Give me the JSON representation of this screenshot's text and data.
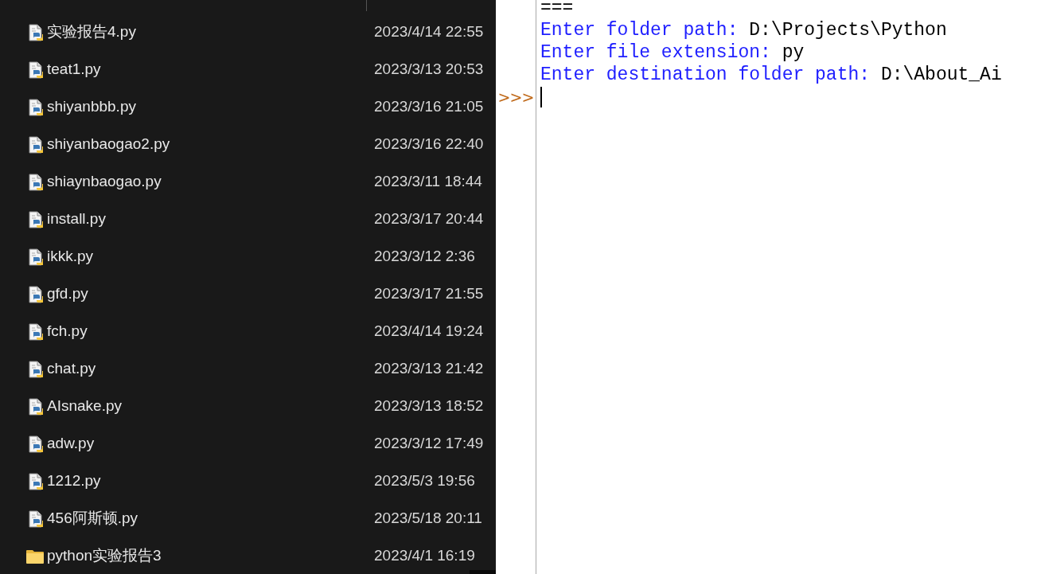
{
  "explorer": {
    "files": [
      {
        "kind": "python-file",
        "name": "实验报告4.py",
        "modified": "2023/4/14 22:55"
      },
      {
        "kind": "python-file",
        "name": "teat1.py",
        "modified": "2023/3/13 20:53"
      },
      {
        "kind": "python-file",
        "name": "shiyanbbb.py",
        "modified": "2023/3/16 21:05"
      },
      {
        "kind": "python-file",
        "name": "shiyanbaogao2.py",
        "modified": "2023/3/16 22:40"
      },
      {
        "kind": "python-file",
        "name": "shiaynbaogao.py",
        "modified": "2023/3/11 18:44"
      },
      {
        "kind": "python-file",
        "name": "install.py",
        "modified": "2023/3/17 20:44"
      },
      {
        "kind": "python-file",
        "name": "ikkk.py",
        "modified": "2023/3/12 2:36"
      },
      {
        "kind": "python-file",
        "name": "gfd.py",
        "modified": "2023/3/17 21:55"
      },
      {
        "kind": "python-file",
        "name": "fch.py",
        "modified": "2023/4/14 19:24"
      },
      {
        "kind": "python-file",
        "name": "chat.py",
        "modified": "2023/3/13 21:42"
      },
      {
        "kind": "python-file",
        "name": "AIsnake.py",
        "modified": "2023/3/13 18:52"
      },
      {
        "kind": "python-file",
        "name": "adw.py",
        "modified": "2023/3/12 17:49"
      },
      {
        "kind": "python-file",
        "name": "1212.py",
        "modified": "2023/5/3 19:56"
      },
      {
        "kind": "python-file",
        "name": "456阿斯顿.py",
        "modified": "2023/5/18 20:11"
      },
      {
        "kind": "folder",
        "name": "python实验报告3",
        "modified": "2023/4/1 16:19"
      }
    ]
  },
  "shell": {
    "lines": [
      {
        "kind": "separator",
        "text": "==="
      },
      {
        "kind": "io",
        "prompt": "Enter folder path: ",
        "input": "D:\\Projects\\Python"
      },
      {
        "kind": "io",
        "prompt": "Enter file extension: ",
        "input": "py"
      },
      {
        "kind": "io",
        "prompt": "Enter destination folder path: ",
        "input": "D:\\About_Ai"
      }
    ],
    "prompt": ">>>"
  }
}
